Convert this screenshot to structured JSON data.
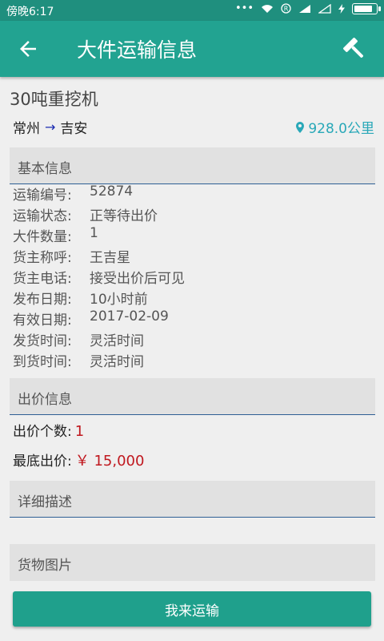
{
  "statusbar": {
    "time": "傍晚6:17",
    "battery_level": 0.9
  },
  "header": {
    "title": "大件运输信息"
  },
  "cargo": {
    "title": "30吨重挖机",
    "origin": "常州",
    "destination": "吉安",
    "distance": "928.0公里"
  },
  "sections": {
    "basic": "基本信息",
    "bid": "出价信息",
    "details": "详细描述",
    "photos": "货物图片"
  },
  "basic_info": [
    {
      "label": "运输编号:",
      "value": "52874"
    },
    {
      "label": "运输状态:",
      "value": "正等待出价"
    },
    {
      "label": "大件数量:",
      "value": "1"
    },
    {
      "label": "货主称呼:",
      "value": "王吉星"
    },
    {
      "label": "货主电话:",
      "value": "接受出价后可见"
    },
    {
      "label": "发布日期:",
      "value": "10小时前"
    },
    {
      "label": "有效日期:",
      "value": "2017-02-09"
    },
    {
      "label": "发货时间:",
      "value": "灵活时间"
    },
    {
      "label": "到货时间:",
      "value": "灵活时间"
    }
  ],
  "bid_info": {
    "count_label": "出价个数:",
    "count_value": "1",
    "min_label": "最底出价:",
    "min_value": "￥ 15,000"
  },
  "action": {
    "label": "我来运输"
  },
  "colors": {
    "primary": "#22a391",
    "status": "#1f8f7e",
    "accent_red": "#c0181f",
    "distance": "#29a8b8"
  }
}
